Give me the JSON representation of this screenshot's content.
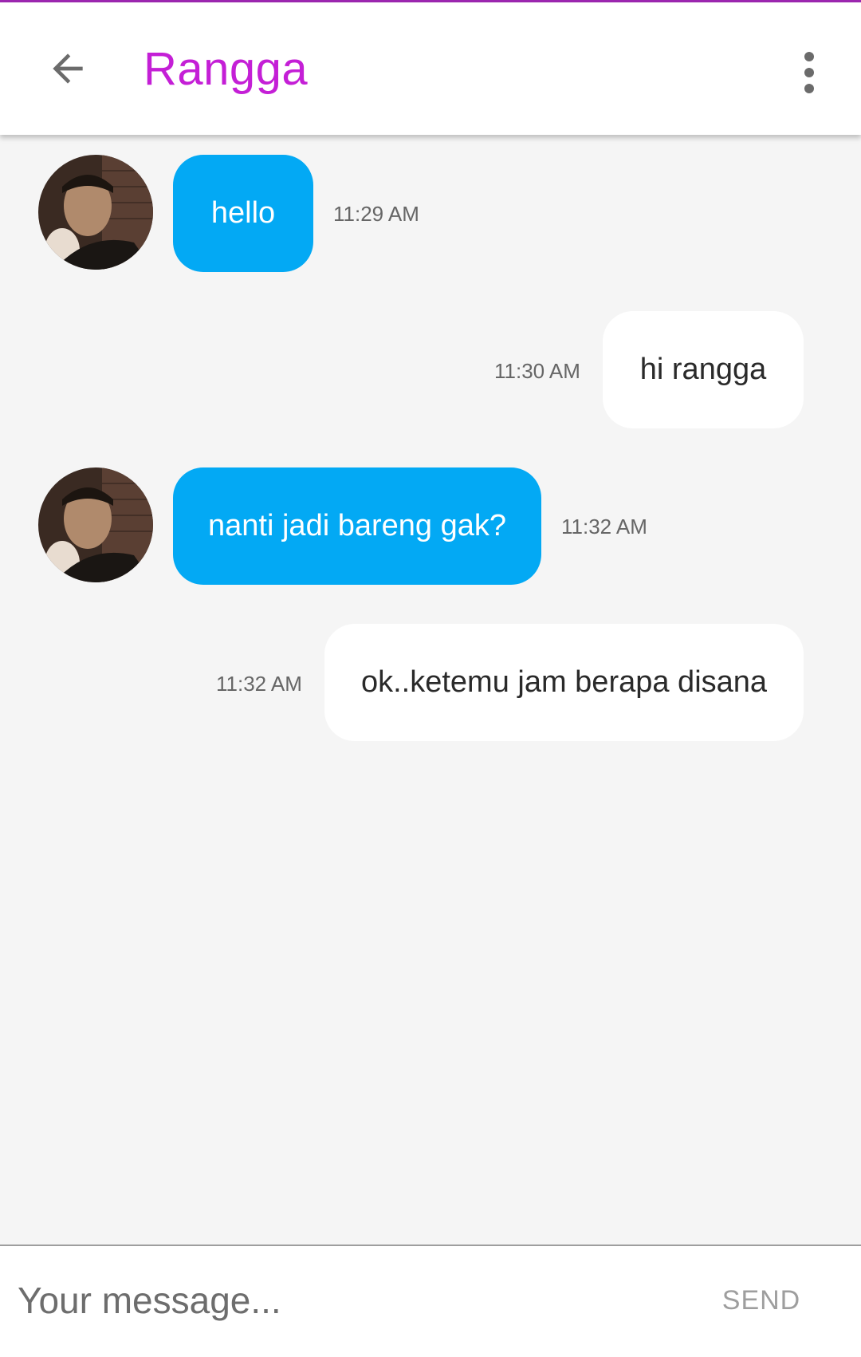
{
  "header": {
    "title": "Rangga",
    "back_icon": "arrow-left-icon",
    "menu_icon": "more-vertical-icon",
    "accent_color": "#c41fd6",
    "top_line_color": "#9c27b0"
  },
  "messages": [
    {
      "direction": "incoming",
      "text": "hello",
      "time": "11:29 AM"
    },
    {
      "direction": "outgoing",
      "text": "hi rangga",
      "time": "11:30 AM"
    },
    {
      "direction": "incoming",
      "text": "nanti jadi bareng gak?",
      "time": "11:32 AM"
    },
    {
      "direction": "outgoing",
      "text": "ok..ketemu jam berapa disana",
      "time": "11:32 AM"
    }
  ],
  "colors": {
    "incoming_bubble": "#03a9f4",
    "outgoing_bubble": "#ffffff",
    "background": "#f5f5f5"
  },
  "composer": {
    "placeholder": "Your message...",
    "value": "",
    "send_label": "SEND"
  }
}
